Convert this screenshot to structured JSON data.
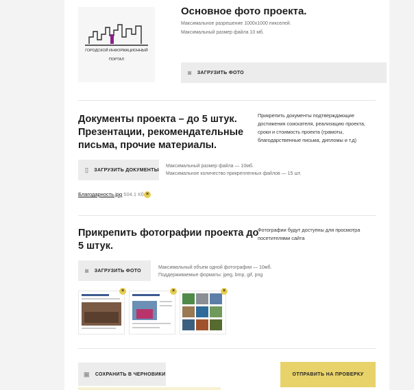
{
  "main_photo": {
    "title": "Основное фото проекта.",
    "hint1": "Максимальное разрешение 1000x1000 пикселей.",
    "hint2": "Максимальный размер файла 10 мб.",
    "upload_label": "ЗАГРУЗИТЬ ФОТО",
    "logo_text_line1": "ГОРОДСКОЙ ИНФОРМАЦИОННЫЙ",
    "logo_text_line2": "ПОРТАЛ"
  },
  "documents": {
    "title_line1": "Документы проекта – до 5 штук.",
    "title_line2": "Презентации, рекомендательные",
    "title_line3": "письма, прочие материалы.",
    "side_text": [
      "Прикрепить документы подтверждающие",
      "достижения соискателя, реализацию проекта,",
      "сроки и стоимость проекта (грамоты,",
      "благодарственные письма, дипломы и т.д)"
    ],
    "upload_label": "ЗАГРУЗИТЬ ДОКУМЕНТЫ",
    "hint1": "Максимальный размер файла — 10мб.",
    "hint2": "Максимальное количество прикрепленных файлов — 15 шт.",
    "file_name": "Благодарность.jpg",
    "file_size": "504.1 Кб"
  },
  "photos": {
    "title_line1": "Прикрепить фотографии проекта до",
    "title_line2": "5 штук.",
    "side_text": [
      "Фотографии будут доступны для просмотра",
      "посетителями сайта"
    ],
    "upload_label": "ЗАГРУЗИТЬ ФОТО",
    "hint1": "Максимальный объем одной фотографии — 10мб.",
    "hint2": "Поддерживаемые форматы: jpeg, bmp, gif, png"
  },
  "actions": {
    "save_label": "СОХРАНИТЬ В ЧЕРНОВИКИ",
    "submit_label": "ОТПРАВИТЬ НА ПРОВЕРКУ"
  },
  "colors": {
    "accent": "#e8d26a",
    "button_bg": "#ececec",
    "remove_badge": "#e8cd4f",
    "logo_purple": "#8a1f8c"
  },
  "icons": {
    "camera": "camera-icon",
    "book": "book-icon",
    "save": "save-icon",
    "remove": "close-icon"
  }
}
